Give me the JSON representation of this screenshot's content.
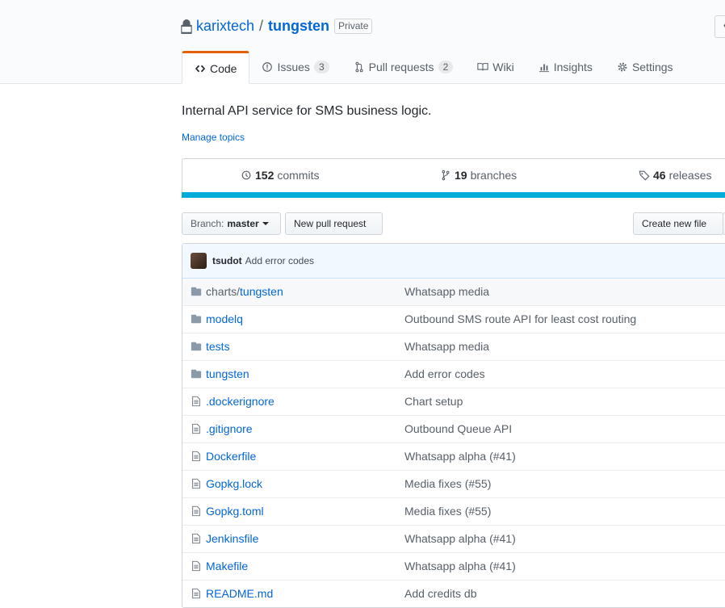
{
  "repo": {
    "owner": "karixtech",
    "separator": "/",
    "name": "tungsten",
    "visibility": "Private"
  },
  "tabs": [
    {
      "label": "Code",
      "icon": "code-icon",
      "selected": true
    },
    {
      "label": "Issues",
      "icon": "issue-icon",
      "count": "3"
    },
    {
      "label": "Pull requests",
      "icon": "pull-request-icon",
      "count": "2"
    },
    {
      "label": "Wiki",
      "icon": "book-icon"
    },
    {
      "label": "Insights",
      "icon": "graph-icon"
    },
    {
      "label": "Settings",
      "icon": "gear-icon"
    }
  ],
  "description": "Internal API service for SMS business logic.",
  "manage_topics": "Manage topics",
  "numbers": {
    "commits_count": "152",
    "commits_label": "commits",
    "branches_count": "19",
    "branches_label": "branches",
    "releases_count": "46",
    "releases_label": "releases"
  },
  "language_color": "#00add8",
  "branch": {
    "prefix": "Branch:",
    "name": "master"
  },
  "buttons": {
    "new_pull_request": "New pull request",
    "create_new_file": "Create new file"
  },
  "latest_commit": {
    "author": "tsudot",
    "message": "Add error codes"
  },
  "files": [
    {
      "type": "dir",
      "prefix": "charts/",
      "name": "tungsten",
      "message": "Whatsapp media"
    },
    {
      "type": "dir",
      "prefix": "",
      "name": "modelq",
      "message": "Outbound SMS route API for least cost routing"
    },
    {
      "type": "dir",
      "prefix": "",
      "name": "tests",
      "message": "Whatsapp media"
    },
    {
      "type": "dir",
      "prefix": "",
      "name": "tungsten",
      "message": "Add error codes"
    },
    {
      "type": "file",
      "prefix": "",
      "name": ".dockerignore",
      "message": "Chart setup"
    },
    {
      "type": "file",
      "prefix": "",
      "name": ".gitignore",
      "message": "Outbound Queue API"
    },
    {
      "type": "file",
      "prefix": "",
      "name": "Dockerfile",
      "message": "Whatsapp alpha (#41)"
    },
    {
      "type": "file",
      "prefix": "",
      "name": "Gopkg.lock",
      "message": "Media fixes (#55)"
    },
    {
      "type": "file",
      "prefix": "",
      "name": "Gopkg.toml",
      "message": "Media fixes (#55)"
    },
    {
      "type": "file",
      "prefix": "",
      "name": "Jenkinsfile",
      "message": "Whatsapp alpha (#41)"
    },
    {
      "type": "file",
      "prefix": "",
      "name": "Makefile",
      "message": "Whatsapp alpha (#41)"
    },
    {
      "type": "file",
      "prefix": "",
      "name": "README.md",
      "message": "Add credits db"
    }
  ]
}
